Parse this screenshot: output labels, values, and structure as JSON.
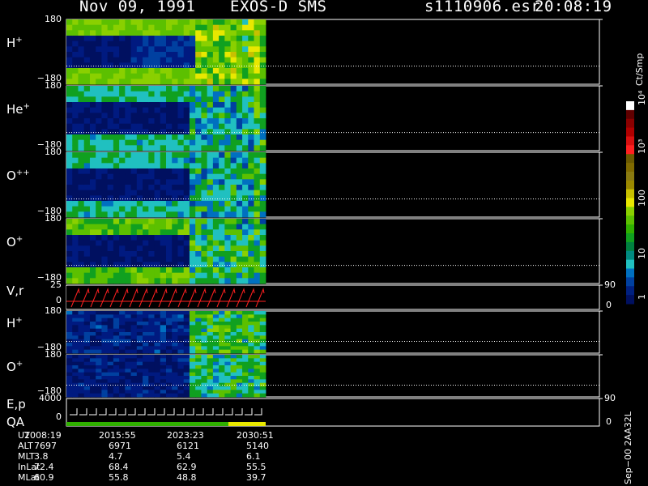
{
  "header": {
    "date": "Nov 09, 1991",
    "instrument": "EXOS-D SMS",
    "file": "s1110906.esr",
    "time": "20:08:19"
  },
  "panels": [
    {
      "key": "h1",
      "label": "H",
      "ion": "+",
      "ytop": "180",
      "ybot": "−180",
      "kind": "spec",
      "profile": "h"
    },
    {
      "key": "he",
      "label": "He",
      "ion": "+",
      "ytop": "180",
      "ybot": "−180",
      "kind": "spec",
      "profile": "he"
    },
    {
      "key": "opp",
      "label": "O",
      "ion": "++",
      "ytop": "180",
      "ybot": "−180",
      "kind": "spec",
      "profile": "opp"
    },
    {
      "key": "o1",
      "label": "O",
      "ion": "+",
      "ytop": "180",
      "ybot": "−180",
      "kind": "spec",
      "profile": "o"
    },
    {
      "key": "vr",
      "label": "V,r",
      "ion": "",
      "ytop": "25",
      "ybot": "0",
      "rtop": "90",
      "rbot": "0",
      "kind": "vr"
    },
    {
      "key": "h2",
      "label": "H",
      "ion": "+",
      "ytop": "180",
      "ybot": "−180",
      "kind": "spec",
      "profile": "h2"
    },
    {
      "key": "o2",
      "label": "O",
      "ion": "+",
      "ytop": "180",
      "ybot": "−180",
      "kind": "spec",
      "profile": "o2"
    },
    {
      "key": "ep",
      "label": "E,p",
      "label2": "QA",
      "ion": "",
      "ytop": "4000",
      "ybot": "0",
      "rtop": "90",
      "rbot": "0",
      "kind": "ep"
    }
  ],
  "colorbar": {
    "unit": "Ct/Smp",
    "ticks": [
      "1",
      "10",
      "100",
      "10³",
      "10⁴"
    ],
    "colors": [
      "#ffffff",
      "#600000",
      "#8b0000",
      "#b00000",
      "#d81010",
      "#ff2020",
      "#6b5a00",
      "#806a00",
      "#8a7a10",
      "#9a8800",
      "#c8c000",
      "#e8e800",
      "#8ad000",
      "#5cc000",
      "#30b000",
      "#10a020",
      "#008040",
      "#008a80",
      "#20c0c0",
      "#0070c0",
      "#0040a0",
      "#002080",
      "#001060"
    ]
  },
  "footer_note": "Sep−00 2AA32L",
  "info": {
    "labels": [
      "UT",
      "ALT",
      "MLT",
      "InLat",
      "MLat"
    ],
    "columns": [
      [
        "2008:19",
        "7697",
        "3.8",
        "72.4",
        "60.9"
      ],
      [
        "2015:55",
        "6971",
        "4.7",
        "68.4",
        "55.8"
      ],
      [
        "2023:23",
        "6121",
        "5.4",
        "62.9",
        "48.8"
      ],
      [
        "2030:51",
        "5140",
        "6.1",
        "55.5",
        "39.7"
      ]
    ]
  }
}
